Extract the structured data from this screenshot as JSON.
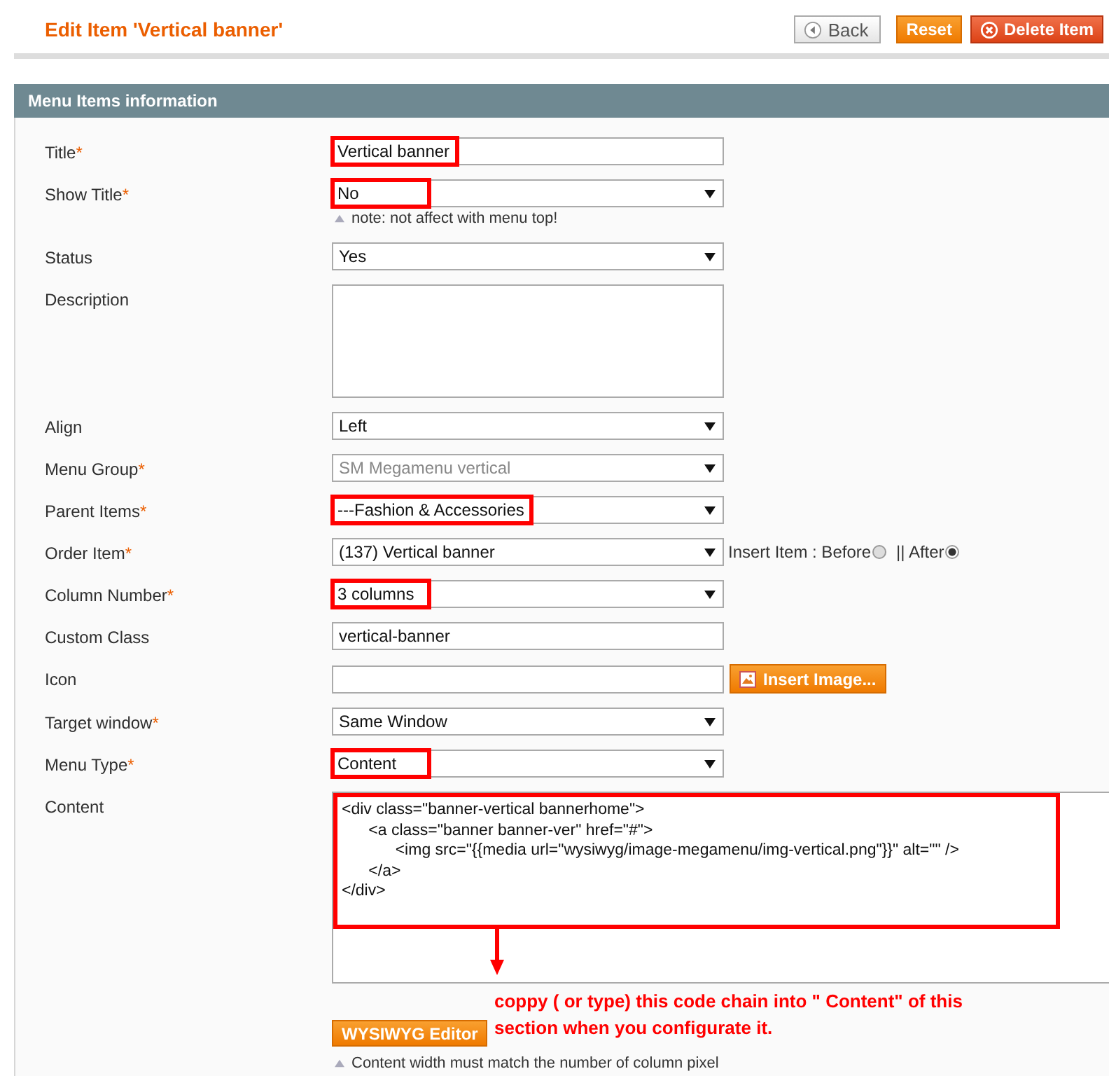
{
  "page_title": "Edit Item 'Vertical banner'",
  "header_buttons": [
    {
      "label": "Back",
      "kind": "back"
    },
    {
      "label": "Reset",
      "kind": "reset"
    },
    {
      "label": "Delete Item",
      "kind": "delete"
    }
  ],
  "section": {
    "title": "Menu Items information"
  },
  "fields": [
    {
      "label": "Title",
      "mark": "*",
      "kind": "text",
      "value": "Vertical banner",
      "highlighted": true
    },
    {
      "label": "Show Title",
      "mark": "*",
      "kind": "select",
      "value": "No",
      "highlighted": true,
      "note": "note: not affect with menu top!"
    },
    {
      "label": "Status",
      "kind": "select",
      "value": "Yes"
    },
    {
      "label": "Description",
      "kind": "textarea"
    },
    {
      "label": "Align",
      "kind": "select",
      "value": "Left"
    },
    {
      "label": "Menu Group",
      "mark": "*",
      "kind": "select",
      "value": "SM Megamenu vertical",
      "disabled": true
    },
    {
      "label": "Parent Items",
      "mark": "*",
      "kind": "select",
      "value": "---Fashion & Accessories",
      "highlighted": true
    },
    {
      "label": "Order Item",
      "mark": "*",
      "kind": "select",
      "value": "(137) Vertical banner",
      "radios": [
        {
          "label": "Insert Item : Before",
          "selected": false
        },
        {
          "label": "|| After",
          "selected": true
        }
      ]
    },
    {
      "label": "Column Number",
      "mark": "*",
      "kind": "select",
      "value": "3 columns",
      "highlighted": true
    },
    {
      "label": "Custom Class",
      "kind": "text",
      "value": "vertical-banner"
    },
    {
      "label": "Icon",
      "kind": "text",
      "button": "Insert Image..."
    },
    {
      "label": "Target window",
      "mark": "*",
      "kind": "select",
      "value": "Same Window"
    },
    {
      "label": "Menu Type",
      "mark": "*",
      "kind": "select",
      "value": "Content",
      "highlighted": true
    },
    {
      "label": "Content",
      "kind": "editor",
      "value": "<div class=\"banner-vertical bannerhome\">\n\t<a class=\"banner banner-ver\" href=\"#\">\n\t\t<img src=\"{{media url=\"wysiwyg/image-megamenu/img-vertical.png\"}}\" alt=\"\" />\n\t</a>\n</div>",
      "highlighted": true,
      "annotation": "coppy ( or type) this code chain into \" Content\" of this section when you configurate it.",
      "button": "WYSIWYG Editor",
      "note": "Content width must match the number of column pixel"
    }
  ]
}
